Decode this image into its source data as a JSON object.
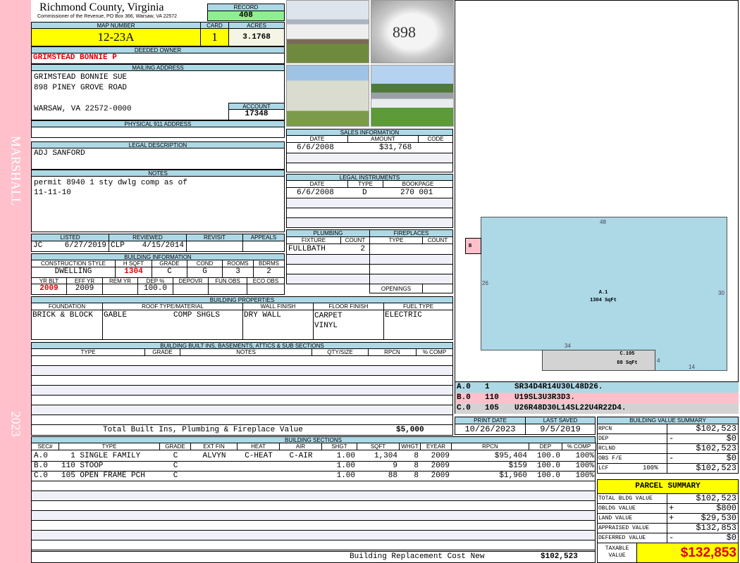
{
  "sidebar": {
    "district": "MARSHALL",
    "year": "2023"
  },
  "header": {
    "county": "Richmond County, Virginia",
    "subtitle": "Commissioner of the Revenue, PO Box 366, Warsaw, VA 22572",
    "record_label": "RECORD",
    "record": "408"
  },
  "parcel": {
    "map_label": "MAP NUMBER",
    "map": "12-23A",
    "card_label": "CARD",
    "card": "1",
    "acres_label": "ACRES",
    "acres": "3.1768"
  },
  "owner": {
    "label": "DEEDED OWNER",
    "name": "GRIMSTEAD BONNIE P"
  },
  "mailing": {
    "label": "MAILING ADDRESS",
    "lines": [
      "GRIMSTEAD BONNIE SUE",
      "898 PINEY GROVE ROAD",
      "WARSAW, VA 22572-0000"
    ]
  },
  "account": {
    "label": "ACCOUNT",
    "value": "17348"
  },
  "physical": {
    "label": "PHYSICAL 911 ADDRESS",
    "value": ""
  },
  "legal": {
    "label": "LEGAL DESCRIPTION",
    "value": "ADJ SANFORD"
  },
  "notes": {
    "label": "NOTES",
    "lines": [
      "permit 8940 1 sty dwlg comp as of",
      "11-11-10"
    ]
  },
  "review": {
    "listed_label": "LISTED",
    "listed_by": "JC",
    "listed_date": "6/27/2019",
    "reviewed_label": "REVIEWED",
    "reviewed_by": "CLP",
    "reviewed_date": "4/15/2014",
    "revisit_label": "REVISIT",
    "appeals_label": "APPEALS"
  },
  "building_info": {
    "label": "BUILDING INFORMATION",
    "h1": [
      "CONSTRUCTION STYLE",
      "H SQFT",
      "GRADE",
      "COND",
      "ROOMS",
      "BDRMS"
    ],
    "v1": [
      "DWELLING",
      "1304",
      "C",
      "G",
      "3",
      "2"
    ],
    "h2": [
      "YR BLT",
      "EFF YR",
      "REM YR",
      "DEP %",
      "DEPOVR",
      "FUN OBS",
      "ECO OBS"
    ],
    "v2": [
      "2009",
      "2009",
      "",
      "100.0",
      "",
      "",
      ""
    ]
  },
  "sales": {
    "label": "SALES INFORMATION",
    "cols": [
      "DATE",
      "AMOUNT",
      "CODE"
    ],
    "rows": [
      [
        "6/6/2008",
        "$31,768",
        ""
      ]
    ]
  },
  "instruments": {
    "label": "LEGAL INSTRUMENTS",
    "cols": [
      "DATE",
      "TYPE",
      "BOOKPAGE"
    ],
    "rows": [
      [
        "6/6/2008",
        "D",
        "270 001"
      ]
    ]
  },
  "plumbing": {
    "label": "PLUMBING",
    "cols": [
      "FIXTURE",
      "COUNT"
    ],
    "rows": [
      [
        "FULLBATH",
        "2"
      ]
    ]
  },
  "fireplaces": {
    "label": "FIREPLACES",
    "cols": [
      "TYPE",
      "COUNT"
    ],
    "openings_label": "OPENINGS"
  },
  "properties": {
    "label": "BUILDING PROPERTIES",
    "cols": [
      "FOUNDATION",
      "ROOF TYPE/MATERIAL",
      "WALL FINISH",
      "FLOOR FINISH",
      "FUEL TYPE"
    ],
    "foundation": "BRICK & BLOCK",
    "roof_type": "GABLE",
    "roof_material": "COMP SHGLS",
    "wall": "DRY WALL",
    "floor": [
      "CARPET",
      "VINYL"
    ],
    "fuel": "ELECTRIC"
  },
  "builtins": {
    "label": "BUILDING BUILT INS, BASEMENTS, ATTICS & SUB SECTIONS",
    "cols": [
      "TYPE",
      "GRADE",
      "NOTES",
      "QTY/SIZE",
      "RPCN",
      "% COMP"
    ],
    "total_label": "Total Built Ins, Plumbing & Fireplace Value",
    "total": "$5,000"
  },
  "sections": {
    "label": "BUILDING SECTIONS",
    "cols": [
      "SEC#",
      "TYPE",
      "GRADE",
      "EXT FIN",
      "HEAT",
      "AIR",
      "SHGT",
      "SQFT",
      "WHGT",
      "EYEAR",
      "RPCN",
      "DEP",
      "% COMP"
    ],
    "rows": [
      [
        "A.0",
        "  1 SINGLE FAMILY",
        "C",
        "ALVYN",
        "C-HEAT",
        "C-AIR",
        "1.00",
        "1,304",
        "8",
        "2009",
        "$95,404",
        "100.0",
        "100%"
      ],
      [
        "B.0",
        "110 STOOP",
        "C",
        "",
        "",
        "",
        "1.00",
        "9",
        "8",
        "2009",
        "$159",
        "100.0",
        "100%"
      ],
      [
        "C.0",
        "105 OPEN FRAME PCH",
        "C",
        "",
        "",
        "",
        "1.00",
        "88",
        "8",
        "2009",
        "$1,960",
        "100.0",
        "100%"
      ]
    ],
    "footer_label": "Building Replacement Cost New",
    "footer_value": "$102,523"
  },
  "sketch": {
    "a_label": "A.1",
    "a_area": "1304 SqFt",
    "b_label": "B",
    "c_label": "C.105",
    "c_area": "88 SqFt",
    "dims": [
      "48",
      "26",
      "30",
      "34",
      "4",
      "14"
    ],
    "legend": [
      [
        "A.0",
        "1",
        "SR34D4R14U30L48D26."
      ],
      [
        "B.0",
        "110",
        "U19SL3U3R3D3."
      ],
      [
        "C.0",
        "105",
        "U26R48D30L14SL22U4R22D4."
      ]
    ]
  },
  "dates": {
    "print_label": "PRINT DATE",
    "print": "10/26/2023",
    "saved_label": "LAST SAVED",
    "saved": "9/5/2019"
  },
  "value_summary": {
    "label": "BUILDING VALUE SUMMARY",
    "rows": [
      [
        "RPCN",
        "",
        "$102,523"
      ],
      [
        "DEP",
        "-",
        "$0"
      ],
      [
        "RCLND",
        "",
        "$102,523"
      ],
      [
        "OBS F/E",
        "-",
        "$0"
      ],
      [
        "LCF",
        "",
        "$102,523"
      ]
    ],
    "lcf_pct": "100%"
  },
  "parcel_summary": {
    "label": "PARCEL SUMMARY",
    "rows": [
      [
        "TOTAL BLDG VALUE",
        "",
        "$102,523"
      ],
      [
        "OBLDG VALUE",
        "+",
        "$800"
      ],
      [
        "LAND VALUE",
        "+",
        "$29,530"
      ],
      [
        "APPRAISED VALUE",
        "",
        "$132,853"
      ],
      [
        "DEFERRED VALUE",
        "-",
        "$0"
      ]
    ],
    "taxable_label_1": "TAXABLE",
    "taxable_label_2": "VALUE",
    "taxable": "$132,853"
  },
  "colors": {
    "header": "#add8e6",
    "yellow": "#ffff00",
    "green": "#90ee90",
    "pink": "#ffc0cb",
    "red": "#e00000"
  }
}
